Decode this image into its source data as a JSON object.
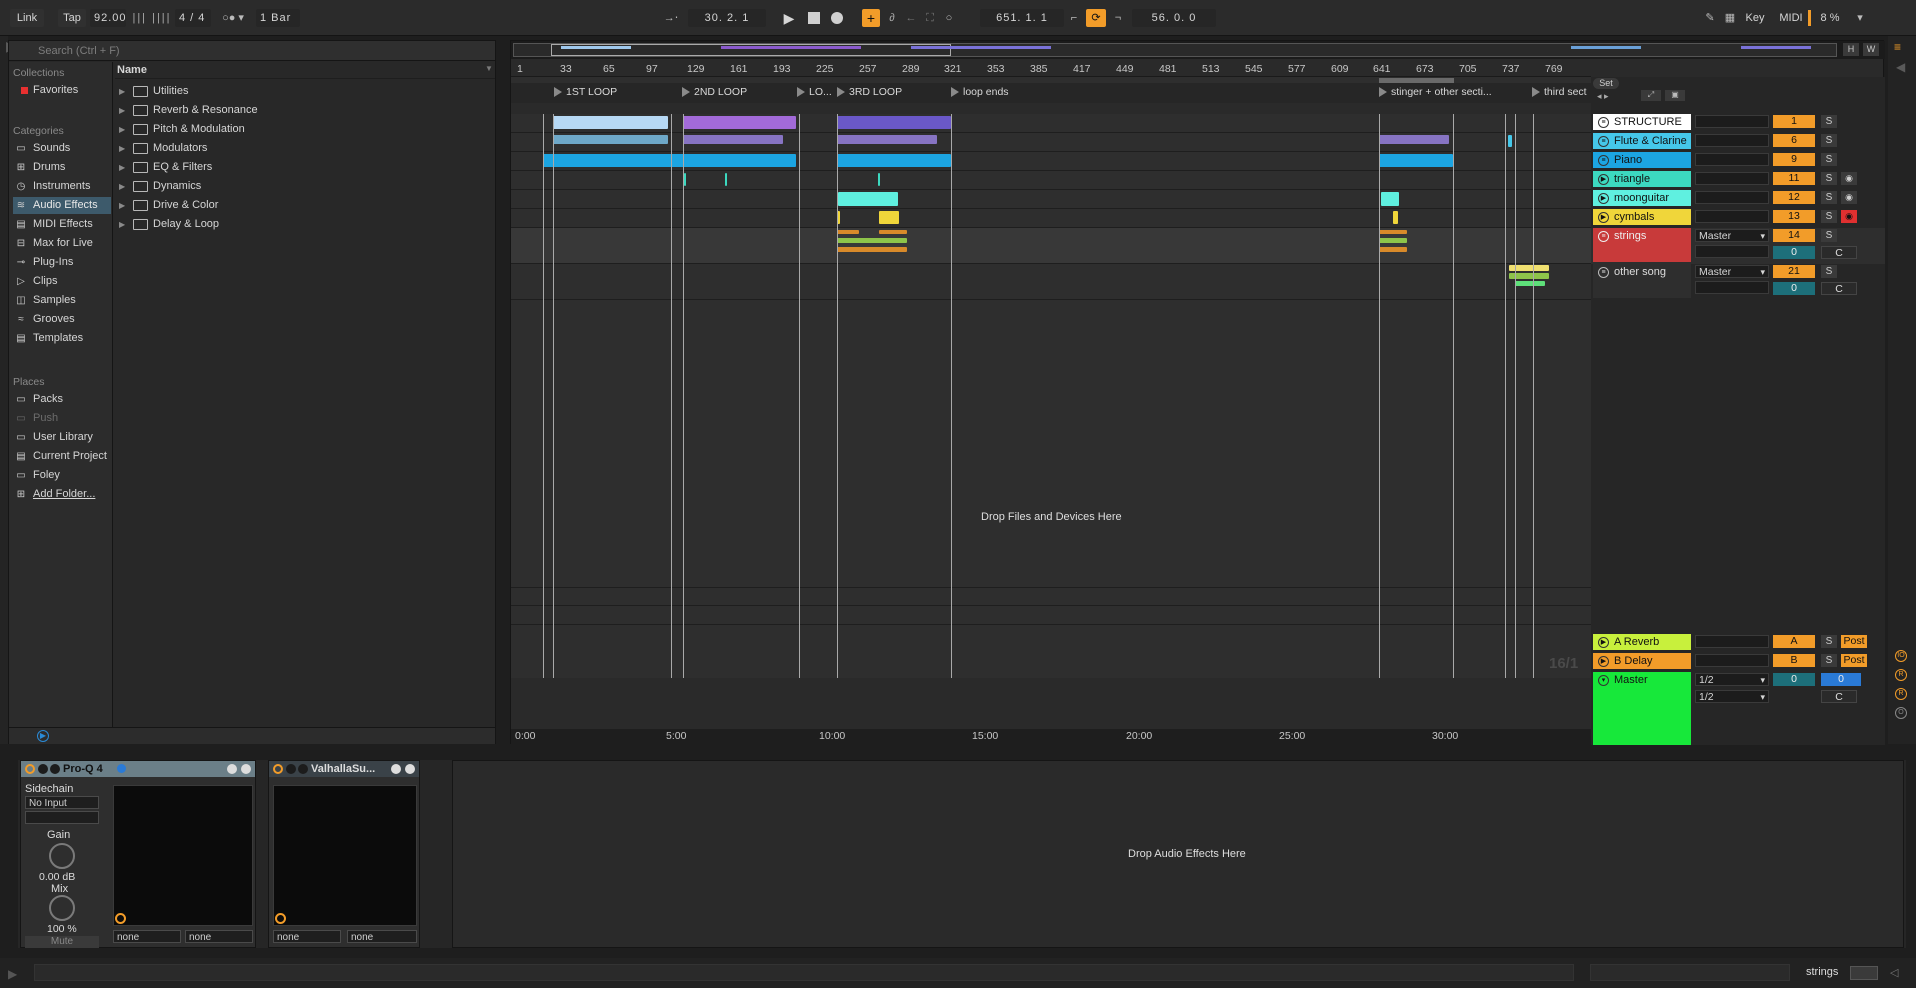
{
  "transport": {
    "link": "Link",
    "tap": "Tap",
    "tempo": "92.00",
    "signature": "4 / 4",
    "quantize": "1 Bar",
    "position": "30. 2. 1",
    "loop_start": "651. 1. 1",
    "loop_length": "56. 0. 0",
    "key": "Key",
    "midi": "MIDI",
    "cpu": "8 %"
  },
  "browser": {
    "search_placeholder": "Search (Ctrl + F)",
    "collections_header": "Collections",
    "favorites": "Favorites",
    "categories_header": "Categories",
    "categories": [
      {
        "label": "Sounds",
        "icon": "sounds-icon"
      },
      {
        "label": "Drums",
        "icon": "drums-icon"
      },
      {
        "label": "Instruments",
        "icon": "instruments-icon"
      },
      {
        "label": "Audio Effects",
        "icon": "audio-effects-icon"
      },
      {
        "label": "MIDI Effects",
        "icon": "midi-effects-icon"
      },
      {
        "label": "Max for Live",
        "icon": "max-icon"
      },
      {
        "label": "Plug-Ins",
        "icon": "plugins-icon"
      },
      {
        "label": "Clips",
        "icon": "clips-icon"
      },
      {
        "label": "Samples",
        "icon": "samples-icon"
      },
      {
        "label": "Grooves",
        "icon": "grooves-icon"
      },
      {
        "label": "Templates",
        "icon": "templates-icon"
      }
    ],
    "places_header": "Places",
    "places": [
      {
        "label": "Packs"
      },
      {
        "label": "Push"
      },
      {
        "label": "User Library"
      },
      {
        "label": "Current Project"
      },
      {
        "label": "Foley"
      },
      {
        "label": "Add Folder..."
      }
    ],
    "name_header": "Name",
    "folders": [
      "Utilities",
      "Reverb & Resonance",
      "Pitch & Modulation",
      "Modulators",
      "EQ & Filters",
      "Dynamics",
      "Drive & Color",
      "Delay & Loop"
    ]
  },
  "arrangement": {
    "bar_numbers": [
      "1",
      "33",
      "65",
      "97",
      "129",
      "161",
      "193",
      "225",
      "257",
      "289",
      "321",
      "353",
      "385",
      "417",
      "449",
      "481",
      "513",
      "545",
      "577",
      "609",
      "641",
      "673",
      "705",
      "737",
      "769"
    ],
    "locators": [
      "1ST LOOP",
      "2ND LOOP",
      "LO...",
      "3RD LOOP",
      "loop ends",
      "stinger + other secti...",
      "third sect"
    ],
    "set_label": "Set",
    "drop_files": "Drop Files and Devices Here",
    "time_labels": [
      "0:00",
      "5:00",
      "10:00",
      "15:00",
      "20:00",
      "25:00",
      "30:00"
    ],
    "zoom_label": "16/1",
    "overview_buttons": [
      "H",
      "W"
    ]
  },
  "tracks": [
    {
      "name": "STRUCTURE",
      "num": "1",
      "color": "#ffffff"
    },
    {
      "name": "Flute & Clarine",
      "num": "6",
      "color": "#45c8ea"
    },
    {
      "name": "Piano",
      "num": "9",
      "color": "#1ca5e2"
    },
    {
      "name": "triangle",
      "num": "11",
      "color": "#3cd9c0"
    },
    {
      "name": "moonguitar",
      "num": "12",
      "color": "#5ff0e0"
    },
    {
      "name": "cymbals",
      "num": "13",
      "color": "#f0d63a"
    },
    {
      "name": "strings",
      "num": "14",
      "color": "#c83a3a",
      "output": "Master",
      "vol": "0",
      "pan": "C"
    },
    {
      "name": "other song",
      "num": "21",
      "color": "#2e2e2e",
      "output": "Master",
      "vol": "0",
      "pan": "C"
    }
  ],
  "returns": [
    {
      "name": "A Reverb",
      "num": "A",
      "post": "Post",
      "color": "#c8f03c"
    },
    {
      "name": "B Delay",
      "num": "B",
      "post": "Post",
      "color": "#f29c29"
    }
  ],
  "master": {
    "name": "Master",
    "sel1": "1/2",
    "sel2": "1/2",
    "vol": "0",
    "vol2": "0",
    "pan": "C",
    "color": "#17e83a"
  },
  "devices": {
    "proq": {
      "title": "Pro-Q 4",
      "sidechain": "Sidechain",
      "input": "No Input",
      "gain_label": "Gain",
      "gain_value": "0.00 dB",
      "mix_label": "Mix",
      "mix_value": "100 %",
      "mute": "Mute",
      "in1": "none",
      "in2": "none"
    },
    "valhalla": {
      "title": "ValhallaSu...",
      "in1": "none",
      "in2": "none"
    },
    "drop_fx": "Drop Audio Effects Here"
  },
  "status": {
    "track": "strings"
  }
}
